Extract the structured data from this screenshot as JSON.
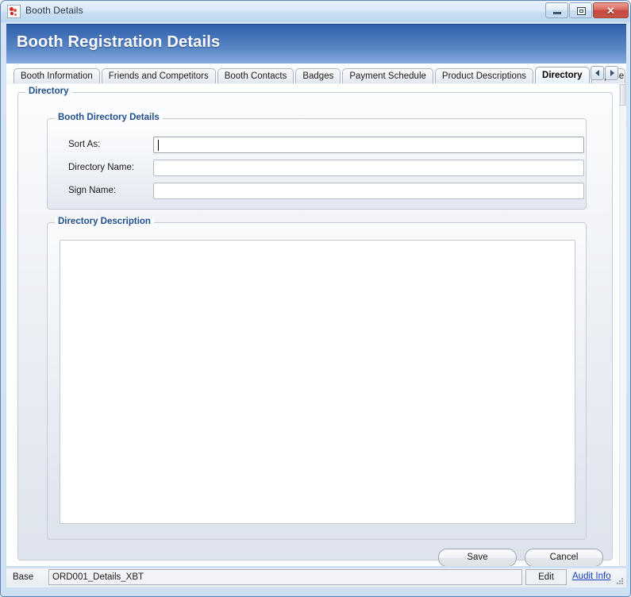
{
  "window": {
    "title": "Booth Details",
    "icon": "app-document-icon",
    "controls": {
      "minimize": "minimize-icon",
      "maximize": "maximize-icon",
      "close": "✕"
    }
  },
  "header": {
    "title": "Booth Registration Details",
    "gradient_top": "#2f60a8",
    "gradient_bottom": "#88aade"
  },
  "tabs": {
    "items": [
      {
        "label": "Booth Information",
        "active": false
      },
      {
        "label": "Friends and Competitors",
        "active": false
      },
      {
        "label": "Booth Contacts",
        "active": false
      },
      {
        "label": "Badges",
        "active": false
      },
      {
        "label": "Payment Schedule",
        "active": false
      },
      {
        "label": "Product Descriptions",
        "active": false
      },
      {
        "label": "Directory",
        "active": true
      },
      {
        "label": "Space",
        "active": false
      }
    ],
    "scroll_left": "◀",
    "scroll_right": "▶"
  },
  "main": {
    "outer_group_legend": "Directory",
    "details_group": {
      "legend": "Booth Directory Details",
      "fields": [
        {
          "label": "Sort As:",
          "value": "",
          "placeholder": "",
          "focused": true
        },
        {
          "label": "Directory Name:",
          "value": "",
          "placeholder": "",
          "focused": false
        },
        {
          "label": "Sign Name:",
          "value": "",
          "placeholder": "",
          "focused": false
        }
      ]
    },
    "description_group": {
      "legend": "Directory Description",
      "value": "",
      "placeholder": ""
    },
    "buttons": {
      "save": "Save",
      "cancel": "Cancel"
    }
  },
  "statusbar": {
    "base_label": "Base",
    "base_value": "ORD001_Details_XBT",
    "edit_label": "Edit",
    "audit_link": "Audit Info"
  },
  "colors": {
    "accent_blue": "#1f4e8c",
    "link_blue": "#1a3fbf",
    "close_red": "#c5483c"
  }
}
